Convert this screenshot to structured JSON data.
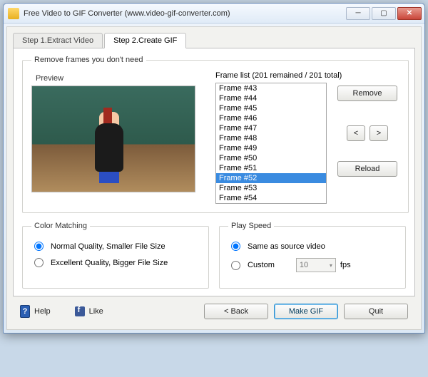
{
  "window": {
    "title": "Free Video to GIF Converter (www.video-gif-converter.com)"
  },
  "tabs": {
    "step1": "Step 1.Extract Video",
    "step2": "Step 2.Create GIF"
  },
  "remove_frames": {
    "legend": "Remove frames you don't need",
    "preview_label": "Preview",
    "frame_list_label": "Frame list (201 remained / 201 total)",
    "frames": [
      "Frame #43",
      "Frame #44",
      "Frame #45",
      "Frame #46",
      "Frame #47",
      "Frame #48",
      "Frame #49",
      "Frame #50",
      "Frame #51",
      "Frame #52",
      "Frame #53",
      "Frame #54"
    ],
    "selected_index": 9,
    "remove_btn": "Remove",
    "prev_btn": "<",
    "next_btn": ">",
    "reload_btn": "Reload"
  },
  "color_matching": {
    "legend": "Color Matching",
    "opt_normal": "Normal Quality, Smaller File Size",
    "opt_excellent": "Excellent Quality, Bigger File Size"
  },
  "play_speed": {
    "legend": "Play Speed",
    "opt_same": "Same as source video",
    "opt_custom": "Custom",
    "fps_value": "10",
    "fps_unit": "fps"
  },
  "footer": {
    "help": "Help",
    "like": "Like",
    "back": "< Back",
    "make_gif": "Make GIF",
    "quit": "Quit"
  }
}
